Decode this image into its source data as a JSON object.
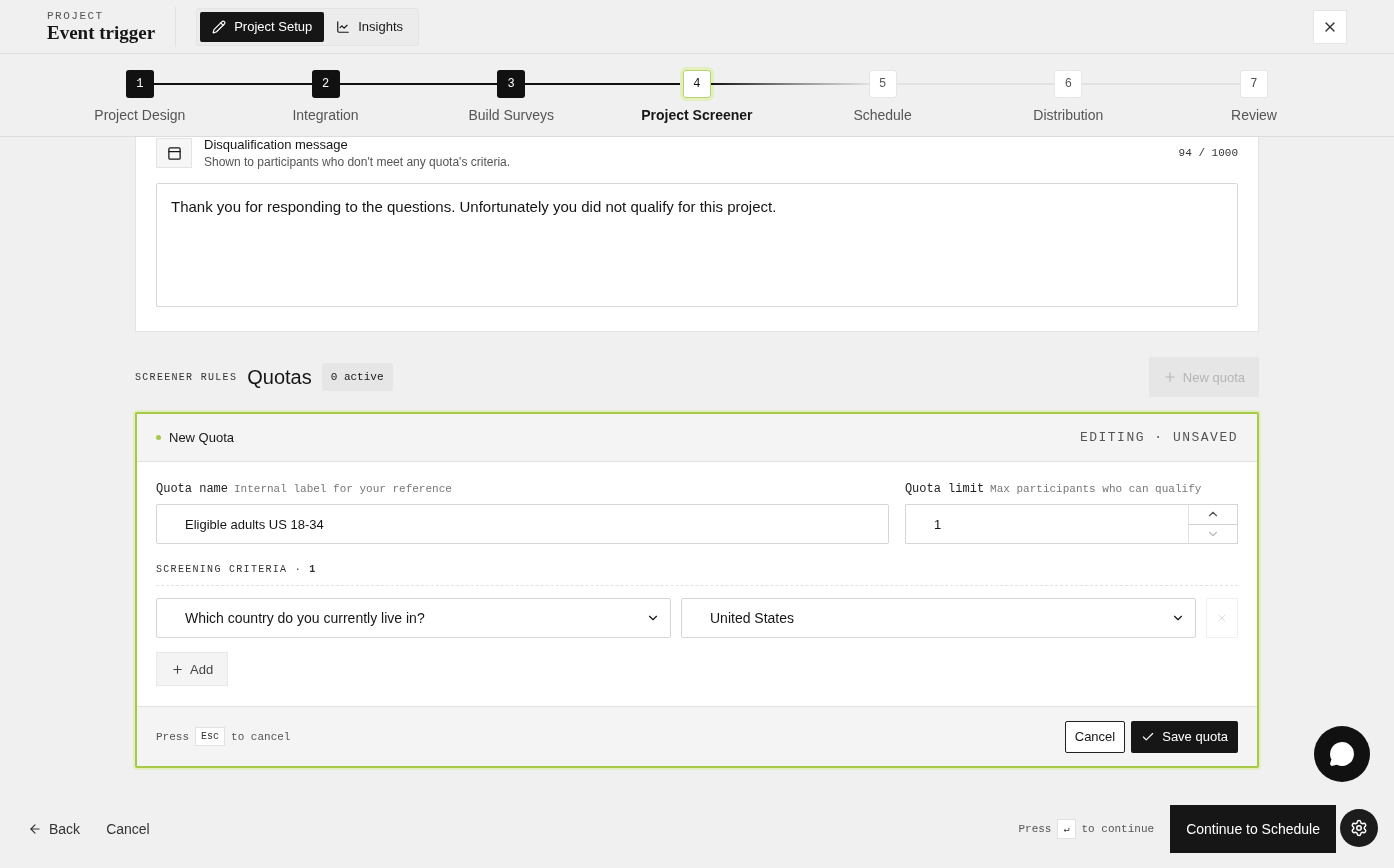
{
  "header": {
    "eyebrow": "PROJECT",
    "title": "Event trigger",
    "tabs": [
      {
        "label": "Project Setup",
        "selected": true
      },
      {
        "label": "Insights",
        "selected": false
      }
    ]
  },
  "stepper": [
    {
      "number": "1",
      "label": "Project Design",
      "kind": "done"
    },
    {
      "number": "2",
      "label": "Integration",
      "kind": "done"
    },
    {
      "number": "3",
      "label": "Build Surveys",
      "kind": "done"
    },
    {
      "number": "4",
      "label": "Project Screener",
      "kind": "current"
    },
    {
      "number": "5",
      "label": "Schedule",
      "kind": "upcoming"
    },
    {
      "number": "6",
      "label": "Distribution",
      "kind": "upcoming"
    },
    {
      "number": "7",
      "label": "Review",
      "kind": "upcoming"
    }
  ],
  "message_card": {
    "title": "Disqualification message",
    "subtitle": "Shown to participants who don't meet any quota's criteria.",
    "counter": "94 / 1000",
    "value": "Thank you for responding to the questions. Unfortunately you did not qualify for this project."
  },
  "quotas": {
    "eyebrow": "SCREENER RULES",
    "title": "Quotas",
    "count_badge": "0 active",
    "new_button": {
      "label": "New quota",
      "disabled": true
    },
    "editor": {
      "title": "New Quota",
      "status": "EDITING · UNSAVED",
      "name_label": "Quota name",
      "name_hint": "Internal label for your reference",
      "name_value": "Eligible adults US 18-34",
      "limit_label": "Quota limit",
      "limit_hint": "Max participants who can qualify",
      "limit_value": "1",
      "criteria_label": "SCREENING CRITERIA · **1**",
      "criteria": [
        {
          "question": "Which country do you currently live in?",
          "answer": "United States",
          "removable": false
        }
      ],
      "add_button": "Add",
      "hint_before": "Press",
      "hint_key": "Esc",
      "hint_after": "to cancel",
      "cancel": "Cancel",
      "save": "Save quota"
    }
  },
  "footer": {
    "back": "Back",
    "cancel": "Cancel",
    "hint_before": "Press",
    "hint_key": "↵",
    "hint_after": "to continue",
    "continue": "Continue to Schedule"
  }
}
